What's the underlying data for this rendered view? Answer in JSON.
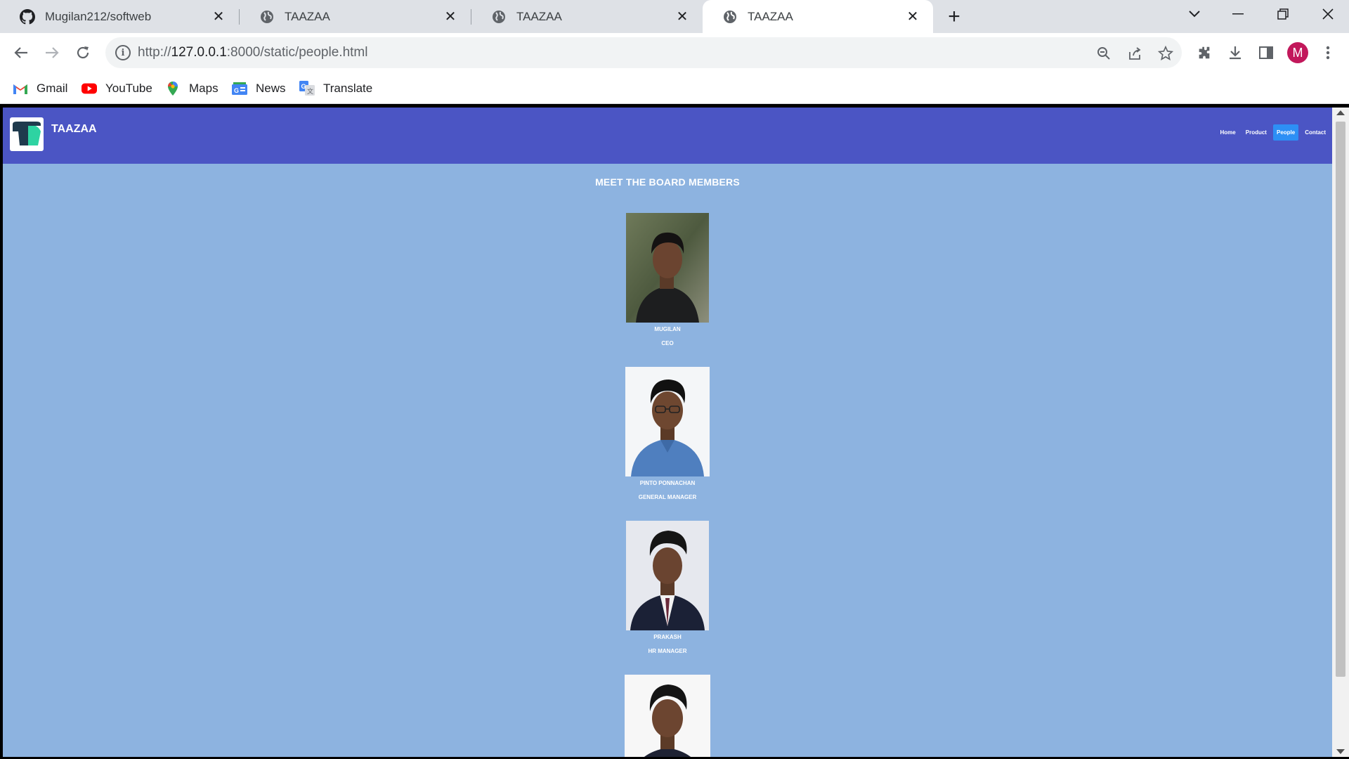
{
  "browser": {
    "tabs": [
      {
        "title": "Mugilan212/softweb",
        "favicon": "github-icon",
        "active": false
      },
      {
        "title": "TAAZAA",
        "favicon": "globe-icon",
        "active": false
      },
      {
        "title": "TAAZAA",
        "favicon": "globe-icon",
        "active": false
      },
      {
        "title": "TAAZAA",
        "favicon": "globe-icon",
        "active": true
      }
    ],
    "address": {
      "scheme": "http://",
      "host": "127.0.0.1",
      "path": ":8000/static/people.html"
    },
    "profile_initial": "M",
    "bookmarks": [
      {
        "label": "Gmail",
        "icon": "gmail-icon"
      },
      {
        "label": "YouTube",
        "icon": "youtube-icon"
      },
      {
        "label": "Maps",
        "icon": "maps-icon"
      },
      {
        "label": "News",
        "icon": "news-icon"
      },
      {
        "label": "Translate",
        "icon": "translate-icon"
      }
    ]
  },
  "site": {
    "brand": "TAAZAA",
    "nav": [
      {
        "label": "Home",
        "active": false
      },
      {
        "label": "Product",
        "active": false
      },
      {
        "label": "People",
        "active": true
      },
      {
        "label": "Contact",
        "active": false
      }
    ],
    "heading": "MEET THE BOARD MEMBERS",
    "members": [
      {
        "name": "MUGILAN",
        "role": "CEO"
      },
      {
        "name": "PINTO PONNACHAN",
        "role": "GENERAL MANAGER"
      },
      {
        "name": "PRAKASH",
        "role": "HR MANAGER"
      },
      {
        "name": "",
        "role": ""
      }
    ]
  },
  "colors": {
    "site_header": "#4b55c4",
    "page_background": "#8db3e0",
    "nav_active": "#2d8ff5",
    "profile_avatar": "#c2185b"
  }
}
